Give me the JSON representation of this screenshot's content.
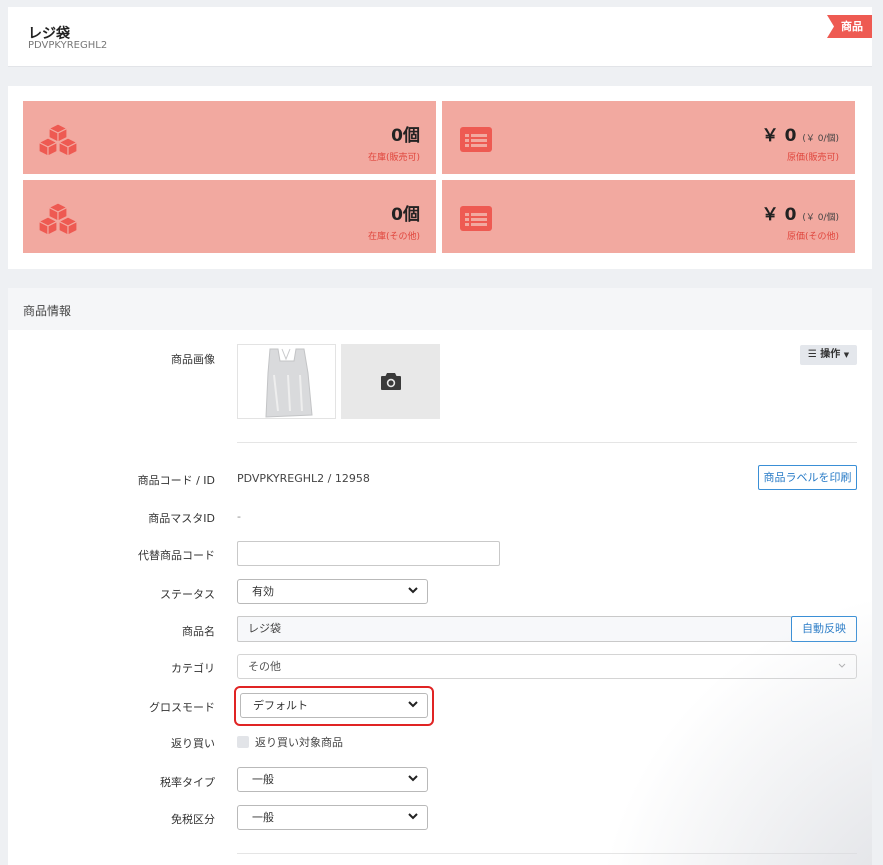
{
  "header": {
    "title": "レジ袋",
    "code": "PDVPKYREGHL2",
    "badge": "商品"
  },
  "stats": [
    {
      "icon": "boxes-icon",
      "value": "0個",
      "unit": "",
      "label": "在庫(販売可)"
    },
    {
      "icon": "list-icon",
      "value": "￥ 0",
      "unit": "(￥ 0/個)",
      "label": "原価(販売可)"
    },
    {
      "icon": "boxes-icon",
      "value": "0個",
      "unit": "",
      "label": "在庫(その他)"
    },
    {
      "icon": "list-icon",
      "value": "￥ 0",
      "unit": "(￥ 0/個)",
      "label": "原価(その他)"
    }
  ],
  "info": {
    "section_title": "商品情報",
    "image_label": "商品画像",
    "operations_label": "操作",
    "code_label": "商品コード / ID",
    "code_value": "PDVPKYREGHL2 / 12958",
    "print_label_button": "商品ラベルを印刷",
    "master_id_label": "商品マスタID",
    "master_id_value": "-",
    "alt_code_label": "代替商品コード",
    "alt_code_value": "",
    "status_label": "ステータス",
    "status_value": "有効",
    "name_label": "商品名",
    "name_value": "レジ袋",
    "auto_reflect_button": "自動反映",
    "category_label": "カテゴリ",
    "category_value": "その他",
    "gross_mode_label": "グロスモード",
    "gross_mode_value": "デフォルト",
    "consignment_label": "返り買い",
    "consignment_checkbox_label": "返り買い対象商品",
    "tax_type_label": "税率タイプ",
    "tax_type_value": "一般",
    "tax_exempt_label": "免税区分",
    "tax_exempt_value": "一般"
  },
  "colors": {
    "stat_bg": "#f2a9a0",
    "stat_icon": "#ee5a52",
    "badge": "#ee5a52",
    "accent_blue": "#2a7cc7",
    "highlight": "#e02424"
  }
}
